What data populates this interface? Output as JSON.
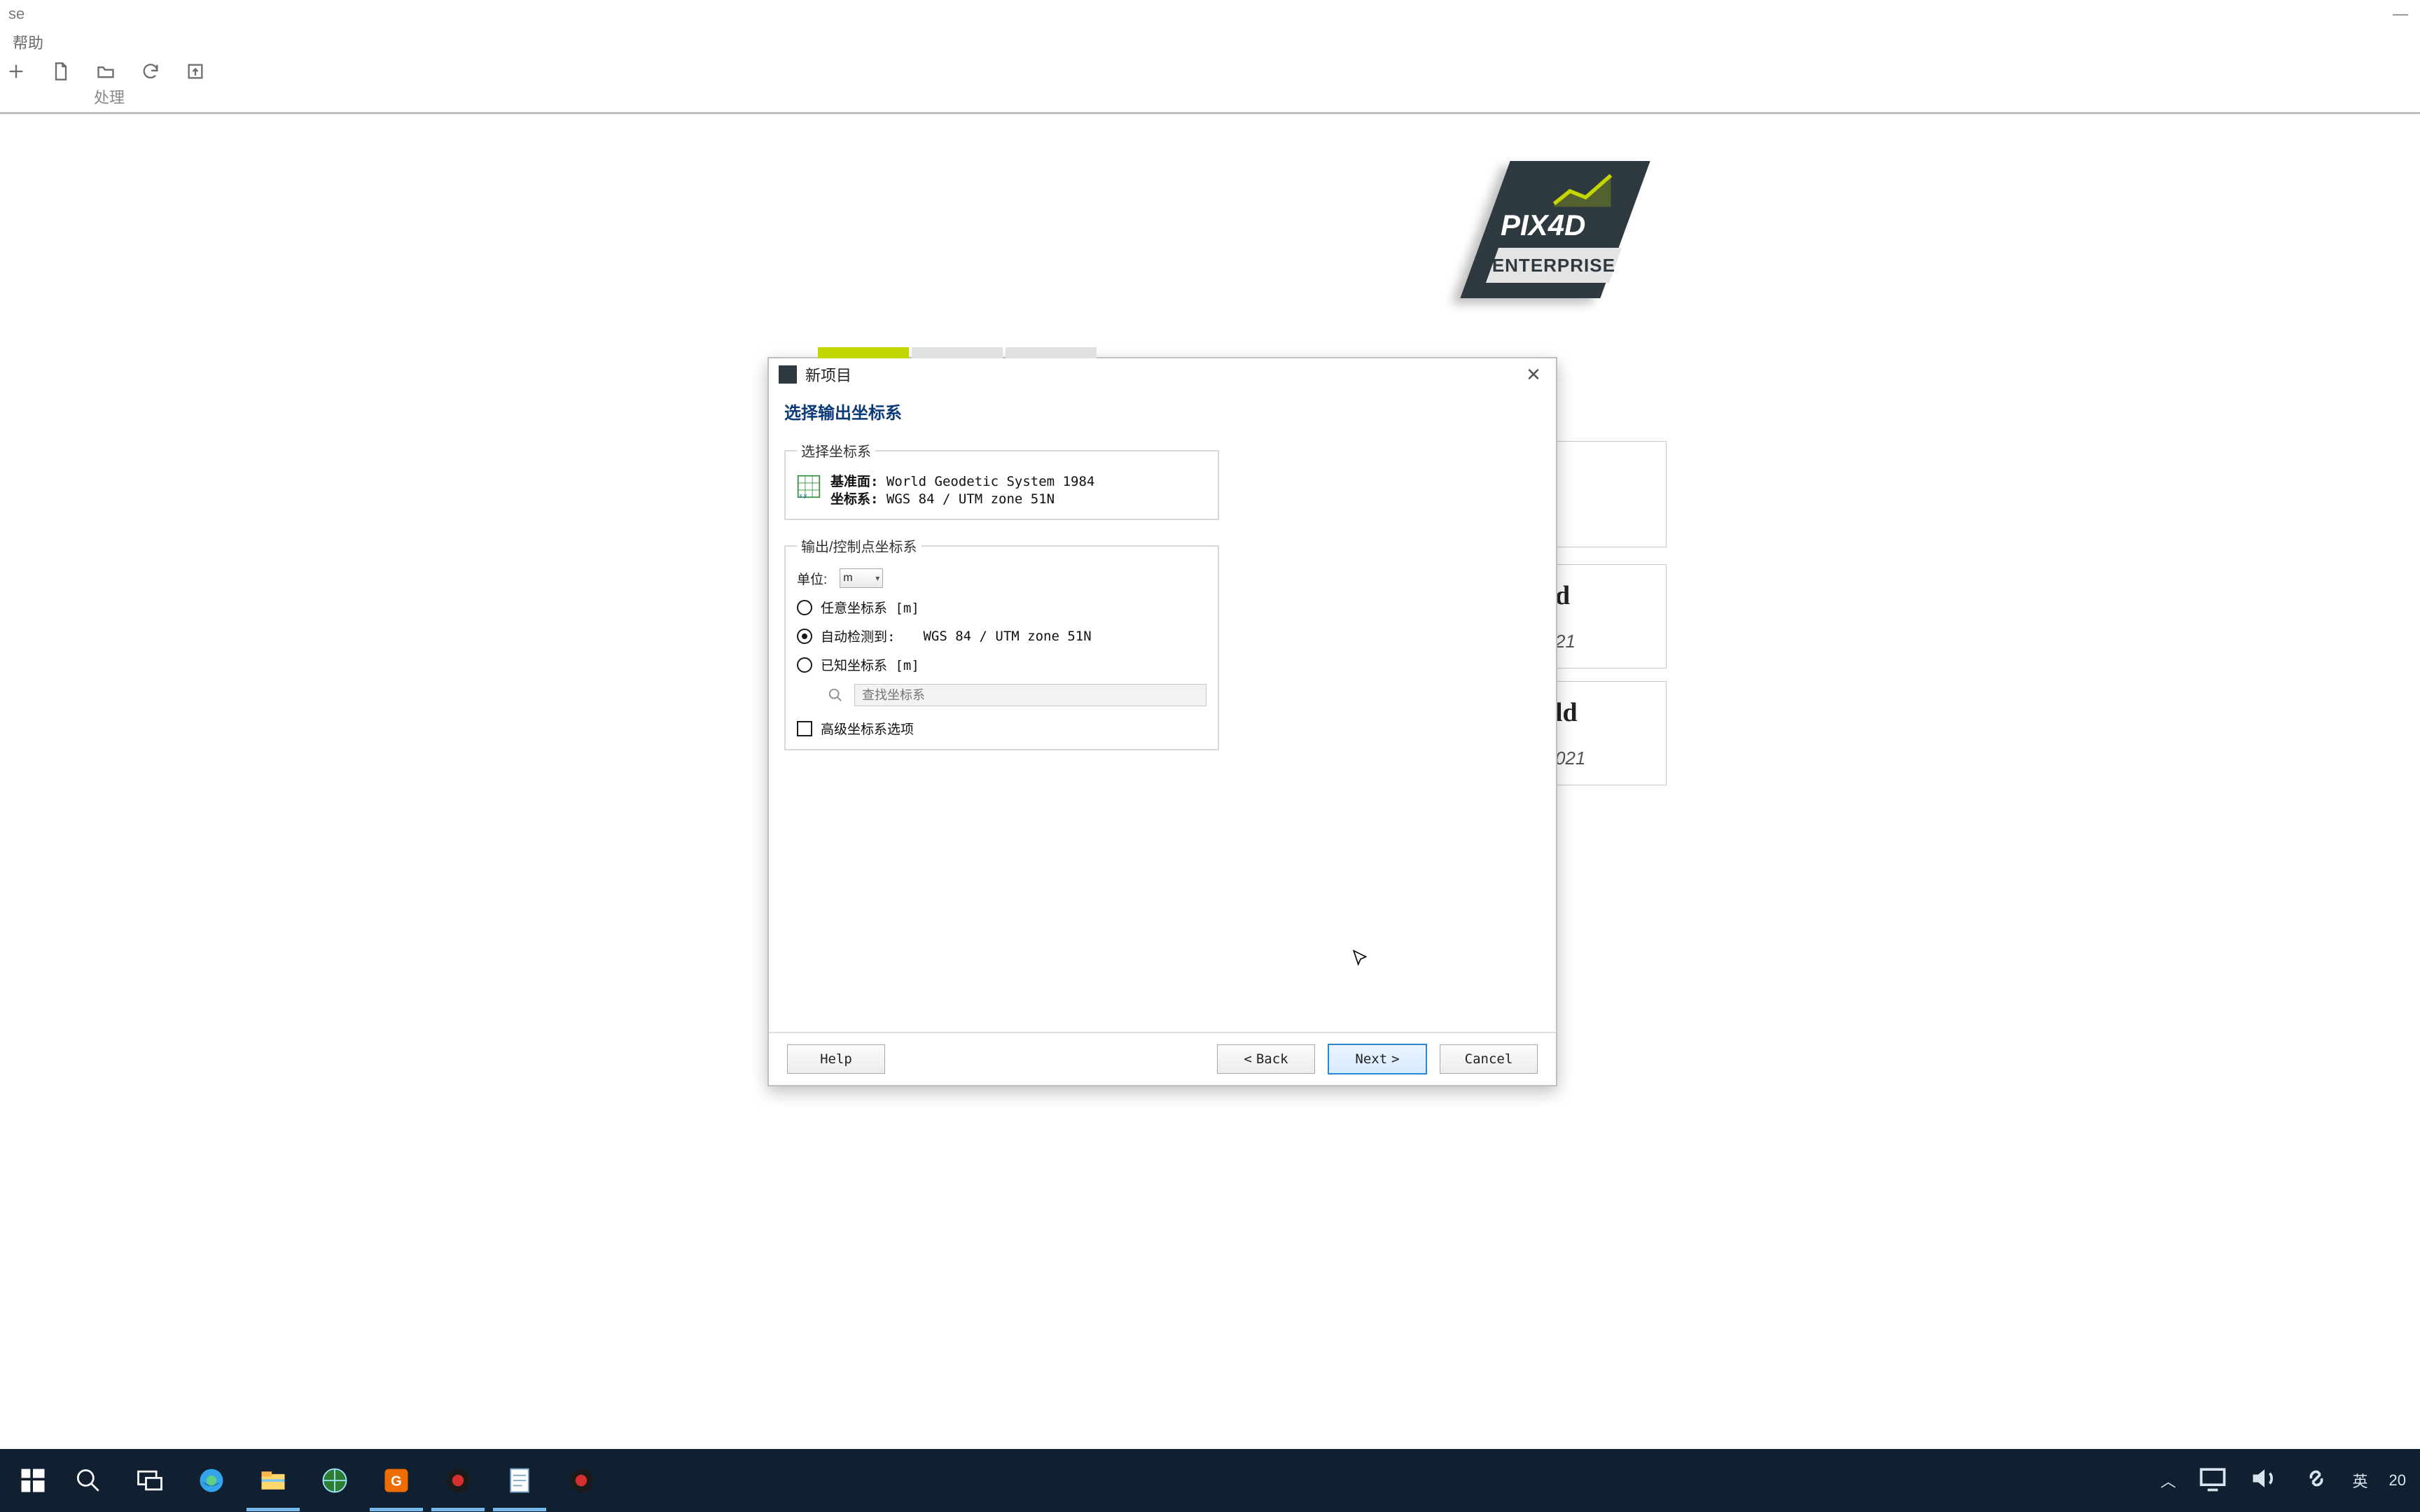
{
  "app": {
    "title_fragment": "se",
    "menu": {
      "item1": "",
      "help": "帮助"
    },
    "ribbon_tab_process": "处理"
  },
  "brand": {
    "name": "PIX4D",
    "edition": "ENTERPRISE"
  },
  "behind": {
    "item1_title_suffix": "d",
    "item1_date_suffix": "21",
    "item2_title_suffix": "ld",
    "item2_date_suffix": "021"
  },
  "dialog": {
    "title": "新项目",
    "heading": "选择输出坐标系",
    "group_select": {
      "legend": "选择坐标系",
      "datum_label": "基准面:",
      "datum_value": "World Geodetic System 1984",
      "cs_label": "坐标系:",
      "cs_value": "WGS 84 / UTM zone 51N"
    },
    "group_output": {
      "legend": "输出/控制点坐标系",
      "unit_label": "单位:",
      "unit_value": "m",
      "radio_any": "任意坐标系 [m]",
      "radio_auto_label": "自动检测到:",
      "radio_auto_value": "WGS 84 / UTM zone 51N",
      "radio_known": "已知坐标系 [m]",
      "search_placeholder": "查找坐标系",
      "advanced_label": "高级坐标系选项"
    },
    "buttons": {
      "help": "Help",
      "back": "Back",
      "next": "Next",
      "cancel": "Cancel"
    }
  },
  "taskbar": {
    "ime_mode": "英",
    "ime_symbol": "⌨",
    "time_fragment": "20"
  }
}
